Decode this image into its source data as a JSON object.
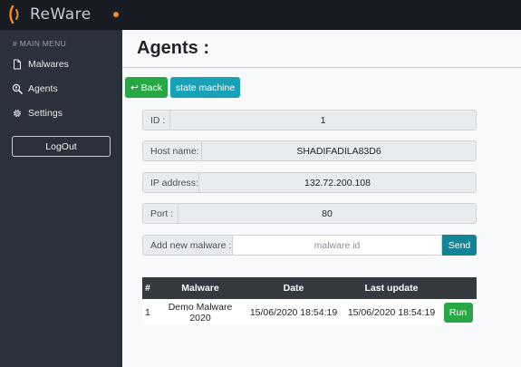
{
  "app": {
    "brand": "ReWare",
    "colors": {
      "topbar": "#171b22",
      "sidebar": "#2a313a",
      "logo_orange": "#f28c28",
      "success": "#28a745",
      "info": "#17a2b8",
      "table_header": "#343a40"
    }
  },
  "sidebar": {
    "heading": "# MAIN MENU",
    "items": [
      {
        "label": "Malwares",
        "icon": "file-icon"
      },
      {
        "label": "Agents",
        "icon": "search-person-icon"
      },
      {
        "label": "Settings",
        "icon": "gear-icon"
      }
    ],
    "logout_label": "LogOut"
  },
  "main": {
    "title": "Agents :",
    "back_label": "↩ Back",
    "state_label": "state machine",
    "fields": {
      "id": {
        "label": "ID :",
        "value": "1"
      },
      "host": {
        "label": "Host name:",
        "value": "SHADIFADILA83D6"
      },
      "ip": {
        "label": "IP address:",
        "value": "132.72.200.108"
      },
      "port": {
        "label": "Port :",
        "value": "80"
      }
    },
    "add_malware": {
      "label": "Add new malware :",
      "placeholder": "malware id",
      "send_label": "Send"
    },
    "table": {
      "headers": [
        "#",
        "Malware",
        "Date",
        "Last update"
      ],
      "rows": [
        {
          "num": "1",
          "malware": "Demo Malware 2020",
          "date": "15/06/2020 18:54:19",
          "last_update": "15/06/2020 18:54:19",
          "action": "Run"
        }
      ]
    }
  }
}
